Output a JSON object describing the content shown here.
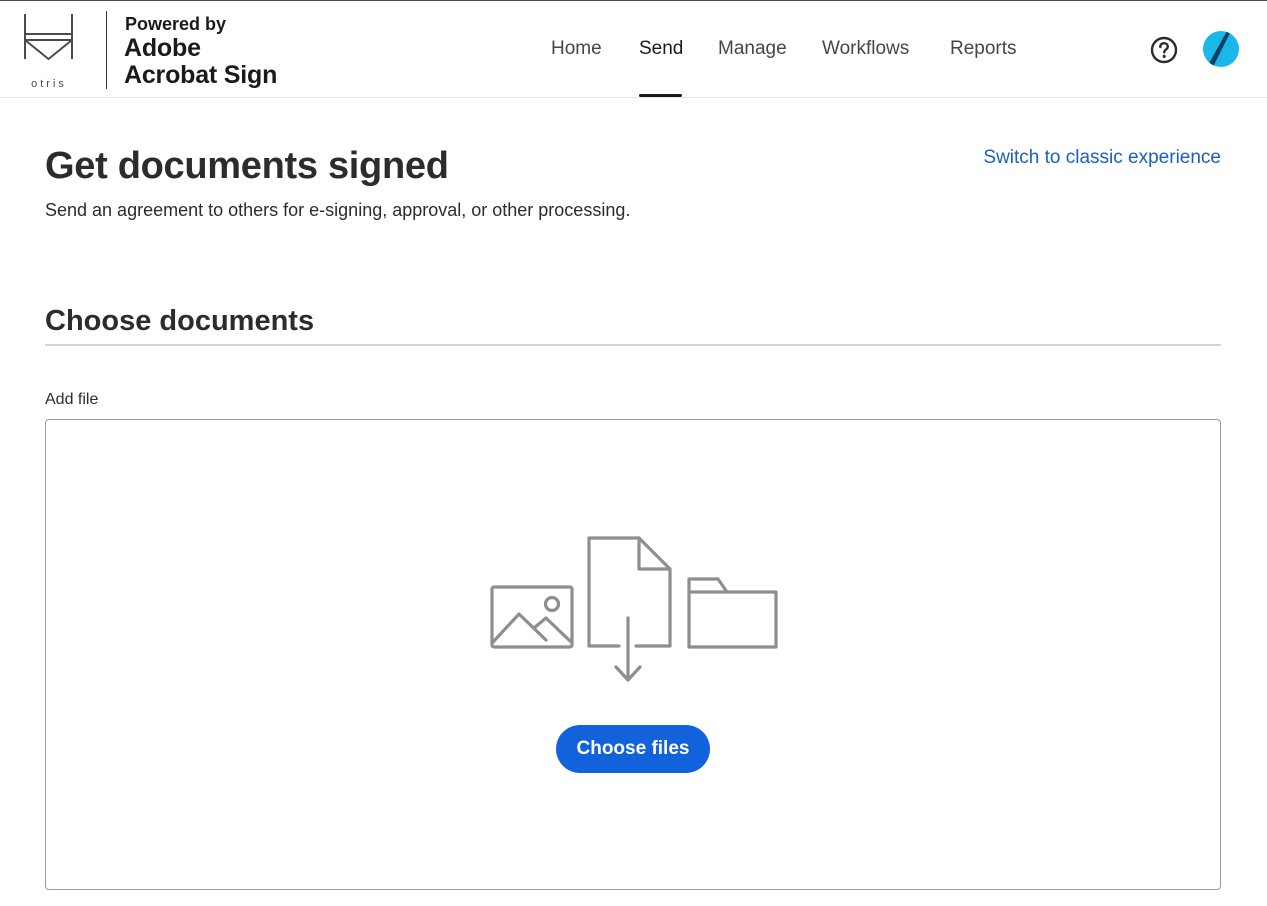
{
  "header": {
    "brand_logo_text": "otris",
    "powered_by": "Powered by",
    "product_line1": "Adobe",
    "product_line2": "Acrobat Sign",
    "nav": [
      {
        "label": "Home",
        "active": false
      },
      {
        "label": "Send",
        "active": true
      },
      {
        "label": "Manage",
        "active": false
      },
      {
        "label": "Workflows",
        "active": false
      },
      {
        "label": "Reports",
        "active": false
      }
    ],
    "help_icon": "question-circle-icon",
    "avatar_icon": "user-avatar-icon"
  },
  "page": {
    "title": "Get documents signed",
    "subtitle": "Send an agreement to others for e-signing, approval, or other processing.",
    "switch_link": "Switch to classic experience"
  },
  "choose_documents": {
    "section_title": "Choose documents",
    "field_label": "Add file",
    "illustration_icons": [
      "image-icon",
      "document-download-icon",
      "folder-icon"
    ],
    "choose_button": "Choose files"
  },
  "colors": {
    "primary_button": "#1262dc",
    "link": "#1c5fbf",
    "avatar": "#1ab8e8",
    "icon_gray": "#8e8e8e"
  }
}
